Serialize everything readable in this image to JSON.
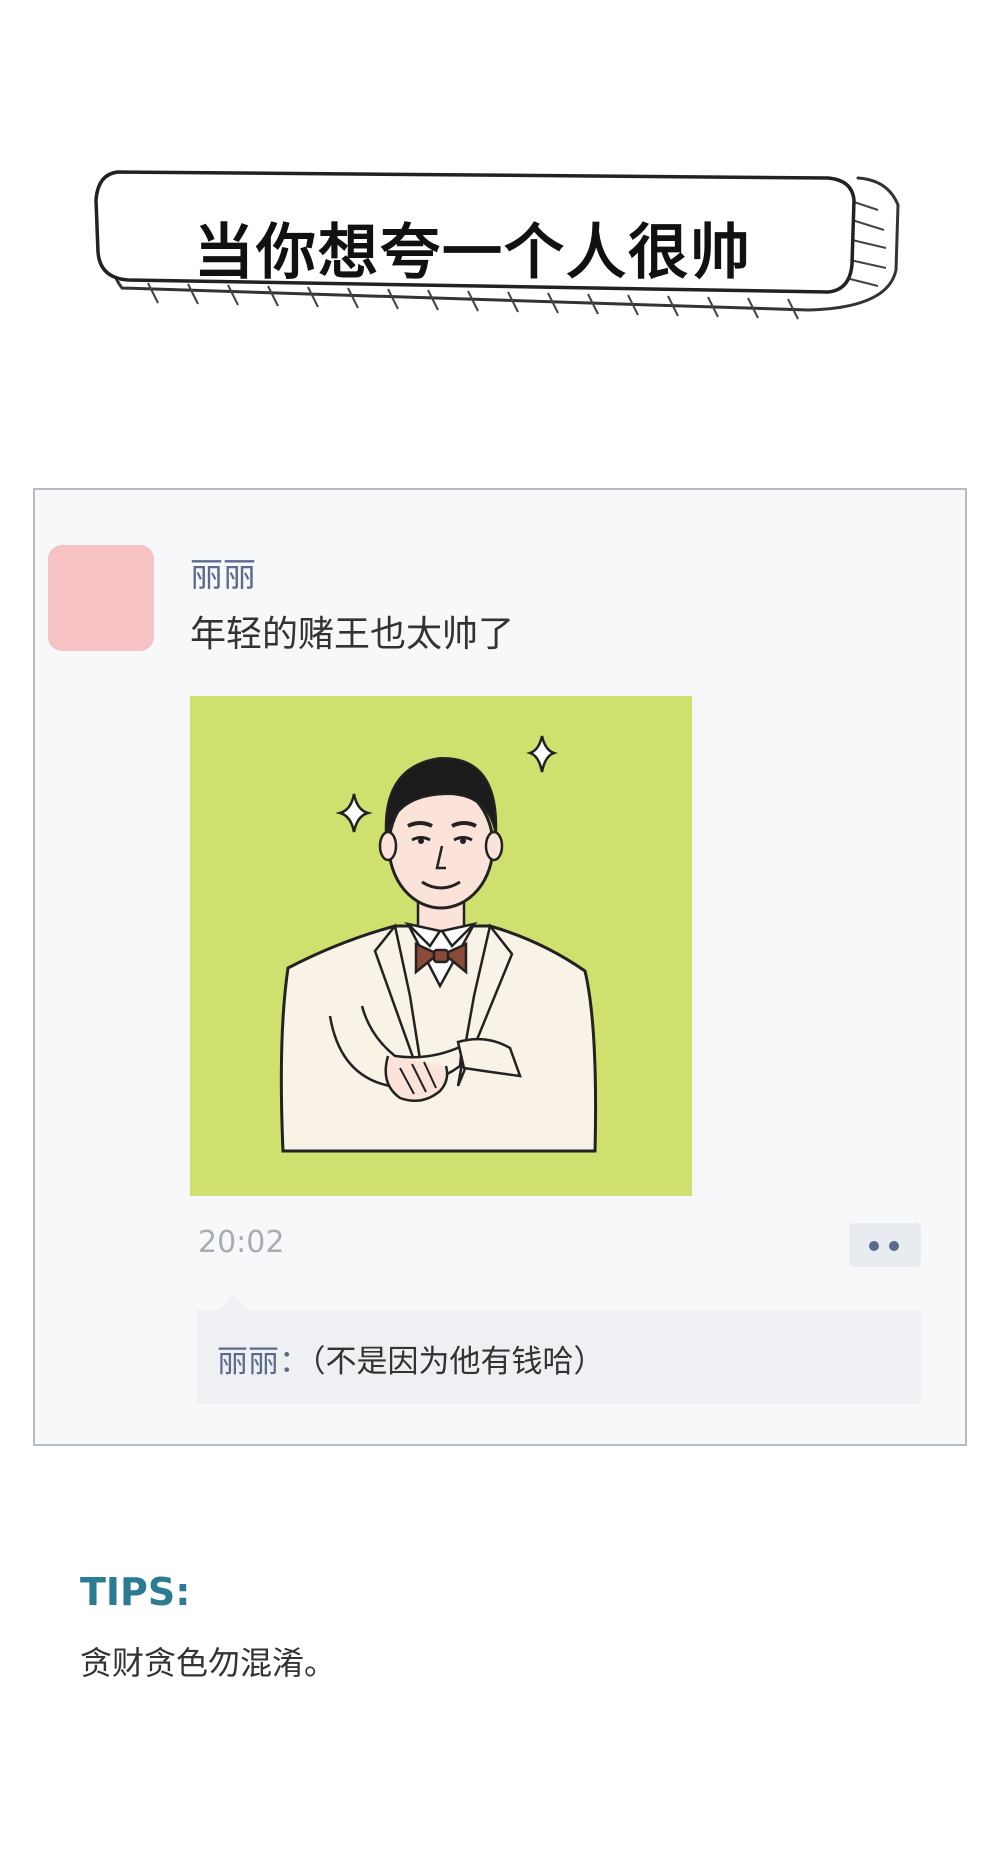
{
  "banner": {
    "title": "当你想夸一个人很帅"
  },
  "post": {
    "username": "丽丽",
    "text": "年轻的赌王也太帅了",
    "image_description_icon": "illustration-man-in-white-suit-with-bow-tie",
    "timestamp": "20:02",
    "comment": {
      "author": "丽丽：",
      "text": "（不是因为他有钱哈）"
    }
  },
  "tips": {
    "heading": "TIPS:",
    "text": "贪财贪色勿混淆。"
  },
  "colors": {
    "accent_name": "#5b6b8c",
    "tips_heading": "#2b7c92",
    "avatar": "#f7c2c3",
    "image_background": "#cfe06e"
  }
}
